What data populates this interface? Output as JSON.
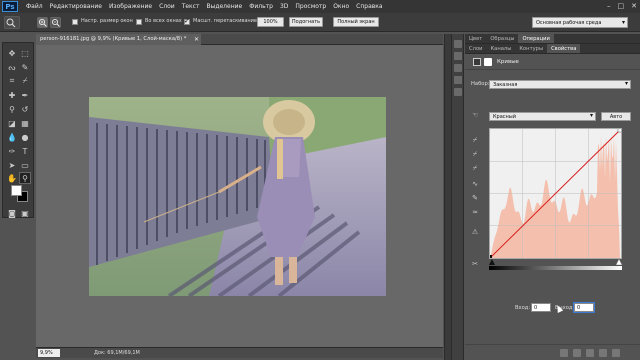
{
  "menubar": {
    "logo": "Ps",
    "items": [
      "Файл",
      "Редактирование",
      "Изображение",
      "Слои",
      "Текст",
      "Выделение",
      "Фильтр",
      "3D",
      "Просмотр",
      "Окно",
      "Справка"
    ],
    "window_controls": [
      "–",
      "□",
      "✕"
    ]
  },
  "options_bar": {
    "resize_windows_label": "Настр. размер окон",
    "all_windows_label": "Во всех окнах",
    "scrubby_zoom_label": "Масшт. перетаскиванием",
    "btn_100": "100%",
    "btn_fit": "Подогнать",
    "btn_fullscreen": "Полный экран",
    "workspace": "Основная рабочая среда",
    "checks": {
      "resize_windows": false,
      "all_windows": false,
      "scrubby_zoom": true
    }
  },
  "document": {
    "tab_title": "person-916181.jpg @ 9,9% (Кривые 1, Слой-маска/8) *",
    "tab_close": "✕",
    "zoom": "9,9%",
    "doc_size": "Док: 69,1M/69,1M"
  },
  "right_panel": {
    "top_tabs": [
      "Цвет",
      "Образцы",
      "Операции"
    ],
    "top_active": 2,
    "second_tabs": [
      "Слои",
      "Каналы",
      "Контуры",
      "Свойства"
    ],
    "second_active": 3,
    "props_title": "Кривые",
    "preset_label": "Набор:",
    "preset_value": "Заказная",
    "channel_value": "Красный",
    "auto_btn": "Авто",
    "input_label": "Вход:",
    "input_value": "0",
    "output_label": "Выход:",
    "output_value": "0"
  },
  "colors": {
    "foreground": "#ffffff",
    "background": "#000000",
    "curve_line": "#d81e1e",
    "histogram_fill": "#f4b9a4"
  }
}
